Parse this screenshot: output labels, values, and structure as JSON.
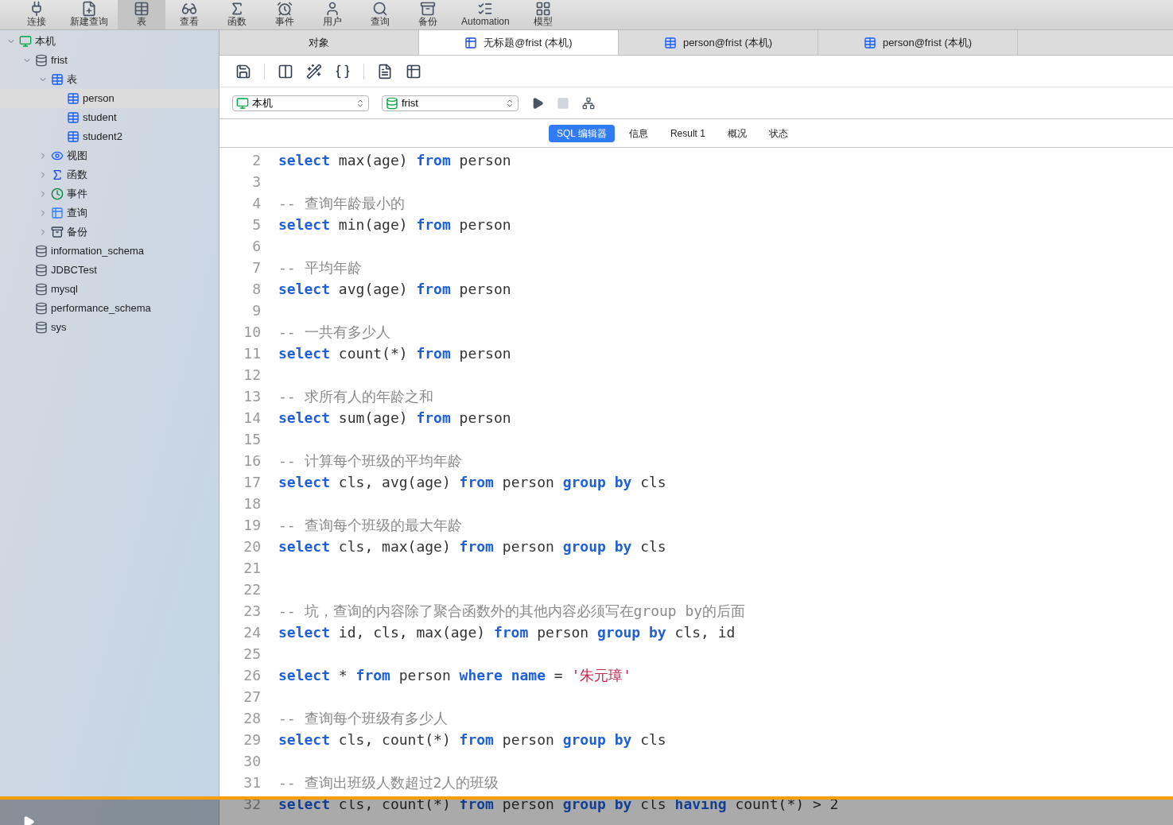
{
  "toolbar": [
    {
      "label": "连接",
      "kind": "connect",
      "selected": false
    },
    {
      "label": "新建查询",
      "kind": "newquery",
      "selected": false
    },
    {
      "label": "表",
      "kind": "table",
      "selected": true
    },
    {
      "label": "查看",
      "kind": "view",
      "selected": false
    },
    {
      "label": "函数",
      "kind": "function",
      "selected": false
    },
    {
      "label": "事件",
      "kind": "event",
      "selected": false
    },
    {
      "label": "用户",
      "kind": "user",
      "selected": false
    },
    {
      "label": "查询",
      "kind": "query",
      "selected": false
    },
    {
      "label": "备份",
      "kind": "backup",
      "selected": false
    },
    {
      "label": "Automation",
      "kind": "automation",
      "selected": false
    },
    {
      "label": "模型",
      "kind": "model",
      "selected": false
    }
  ],
  "sidebar": {
    "items": [
      {
        "label": "本机",
        "kind": "connection",
        "expanded": true,
        "selected": false,
        "children": [
          {
            "label": "frist",
            "kind": "database",
            "expanded": true,
            "selected": false,
            "children": [
              {
                "label": "表",
                "kind": "tables",
                "expanded": true,
                "selected": false,
                "children": [
                  {
                    "label": "person",
                    "kind": "table",
                    "selected": true
                  },
                  {
                    "label": "student",
                    "kind": "table",
                    "selected": false
                  },
                  {
                    "label": "student2",
                    "kind": "table",
                    "selected": false
                  }
                ]
              },
              {
                "label": "视图",
                "kind": "view",
                "expanded": false,
                "selected": false
              },
              {
                "label": "函数",
                "kind": "function",
                "expanded": false,
                "selected": false
              },
              {
                "label": "事件",
                "kind": "event",
                "expanded": false,
                "selected": false
              },
              {
                "label": "查询",
                "kind": "query",
                "expanded": false,
                "selected": false
              },
              {
                "label": "备份",
                "kind": "backup",
                "expanded": false,
                "selected": false
              }
            ]
          },
          {
            "label": "information_schema",
            "kind": "database",
            "selected": false
          },
          {
            "label": "JDBCTest",
            "kind": "database",
            "selected": false
          },
          {
            "label": "mysql",
            "kind": "database",
            "selected": false
          },
          {
            "label": "performance_schema",
            "kind": "database",
            "selected": false
          },
          {
            "label": "sys",
            "kind": "database",
            "selected": false
          }
        ]
      }
    ]
  },
  "tabs": [
    {
      "label": "对象",
      "kind": "objects",
      "selected": false
    },
    {
      "label": "无标题@frist (本机)",
      "kind": "query",
      "selected": true
    },
    {
      "label": "person@frist (本机)",
      "kind": "table",
      "selected": false
    },
    {
      "label": "person@frist (本机)",
      "kind": "table",
      "selected": false
    }
  ],
  "connection_select": {
    "value": "本机"
  },
  "database_select": {
    "value": "frist"
  },
  "editor_tabs": [
    {
      "label": "SQL 编辑器",
      "selected": true
    },
    {
      "label": "信息",
      "selected": false
    },
    {
      "label": "Result 1",
      "selected": false
    },
    {
      "label": "概况",
      "selected": false
    },
    {
      "label": "状态",
      "selected": false
    }
  ],
  "editor": {
    "lines": [
      {
        "number": "2",
        "tokens": [
          {
            "text": "select",
            "kind": "keyword"
          },
          {
            "text": " max(age) ",
            "kind": "plain"
          },
          {
            "text": "from",
            "kind": "keyword"
          },
          {
            "text": " person",
            "kind": "plain"
          }
        ]
      },
      {
        "number": "3"
      },
      {
        "number": "4",
        "tokens": [
          {
            "text": "-- 查询年龄最小的",
            "kind": "comment"
          }
        ]
      },
      {
        "number": "5",
        "tokens": [
          {
            "text": "select",
            "kind": "keyword"
          },
          {
            "text": " min(age) ",
            "kind": "plain"
          },
          {
            "text": "from",
            "kind": "keyword"
          },
          {
            "text": " person",
            "kind": "plain"
          }
        ]
      },
      {
        "number": "6"
      },
      {
        "number": "7",
        "tokens": [
          {
            "text": "-- 平均年龄",
            "kind": "comment"
          }
        ]
      },
      {
        "number": "8",
        "tokens": [
          {
            "text": "select",
            "kind": "keyword"
          },
          {
            "text": " avg(age) ",
            "kind": "plain"
          },
          {
            "text": "from",
            "kind": "keyword"
          },
          {
            "text": " person",
            "kind": "plain"
          }
        ]
      },
      {
        "number": "9"
      },
      {
        "number": "10",
        "tokens": [
          {
            "text": "-- 一共有多少人",
            "kind": "comment"
          }
        ]
      },
      {
        "number": "11",
        "tokens": [
          {
            "text": "select",
            "kind": "keyword"
          },
          {
            "text": " count(*) ",
            "kind": "plain"
          },
          {
            "text": "from",
            "kind": "keyword"
          },
          {
            "text": " person",
            "kind": "plain"
          }
        ]
      },
      {
        "number": "12"
      },
      {
        "number": "13",
        "tokens": [
          {
            "text": "-- 求所有人的年龄之和",
            "kind": "comment"
          }
        ]
      },
      {
        "number": "14",
        "tokens": [
          {
            "text": "select",
            "kind": "keyword"
          },
          {
            "text": " sum(age) ",
            "kind": "plain"
          },
          {
            "text": "from",
            "kind": "keyword"
          },
          {
            "text": " person",
            "kind": "plain"
          }
        ]
      },
      {
        "number": "15"
      },
      {
        "number": "16",
        "tokens": [
          {
            "text": "-- 计算每个班级的平均年龄",
            "kind": "comment"
          }
        ]
      },
      {
        "number": "17",
        "tokens": [
          {
            "text": "select",
            "kind": "keyword"
          },
          {
            "text": " cls, avg(age) ",
            "kind": "plain"
          },
          {
            "text": "from",
            "kind": "keyword"
          },
          {
            "text": " person ",
            "kind": "plain"
          },
          {
            "text": "group by",
            "kind": "keyword"
          },
          {
            "text": " cls",
            "kind": "plain"
          }
        ]
      },
      {
        "number": "18"
      },
      {
        "number": "19",
        "tokens": [
          {
            "text": "-- 查询每个班级的最大年龄",
            "kind": "comment"
          }
        ]
      },
      {
        "number": "20",
        "tokens": [
          {
            "text": "select",
            "kind": "keyword"
          },
          {
            "text": " cls, max(age) ",
            "kind": "plain"
          },
          {
            "text": "from",
            "kind": "keyword"
          },
          {
            "text": " person ",
            "kind": "plain"
          },
          {
            "text": "group by",
            "kind": "keyword"
          },
          {
            "text": " cls",
            "kind": "plain"
          }
        ]
      },
      {
        "number": "21"
      },
      {
        "number": "22"
      },
      {
        "number": "23",
        "tokens": [
          {
            "text": "-- 坑，查询的内容除了聚合函数外的其他内容必须写在group by的后面",
            "kind": "comment"
          }
        ]
      },
      {
        "number": "24",
        "tokens": [
          {
            "text": "select",
            "kind": "keyword"
          },
          {
            "text": " id, cls, max(age) ",
            "kind": "plain"
          },
          {
            "text": "from",
            "kind": "keyword"
          },
          {
            "text": " person ",
            "kind": "plain"
          },
          {
            "text": "group by",
            "kind": "keyword"
          },
          {
            "text": " cls, id",
            "kind": "plain"
          }
        ]
      },
      {
        "number": "25"
      },
      {
        "number": "26",
        "tokens": [
          {
            "text": "select",
            "kind": "keyword"
          },
          {
            "text": " * ",
            "kind": "plain"
          },
          {
            "text": "from",
            "kind": "keyword"
          },
          {
            "text": " person ",
            "kind": "plain"
          },
          {
            "text": "where name",
            "kind": "keyword"
          },
          {
            "text": " = ",
            "kind": "plain"
          },
          {
            "text": "'朱元璋'",
            "kind": "string"
          }
        ]
      },
      {
        "number": "27"
      },
      {
        "number": "28",
        "tokens": [
          {
            "text": "-- 查询每个班级有多少人",
            "kind": "comment"
          }
        ]
      },
      {
        "number": "29",
        "tokens": [
          {
            "text": "select",
            "kind": "keyword"
          },
          {
            "text": " cls, count(*) ",
            "kind": "plain"
          },
          {
            "text": "from",
            "kind": "keyword"
          },
          {
            "text": " person ",
            "kind": "plain"
          },
          {
            "text": "group by",
            "kind": "keyword"
          },
          {
            "text": " cls",
            "kind": "plain"
          }
        ]
      },
      {
        "number": "30"
      },
      {
        "number": "31",
        "tokens": [
          {
            "text": "-- 查询出班级人数超过2人的班级",
            "kind": "comment"
          }
        ]
      },
      {
        "number": "32",
        "tokens": [
          {
            "text": "select",
            "kind": "keyword"
          },
          {
            "text": " cls, count(*) ",
            "kind": "plain"
          },
          {
            "text": "from",
            "kind": "keyword"
          },
          {
            "text": " person ",
            "kind": "plain"
          },
          {
            "text": "group by",
            "kind": "keyword"
          },
          {
            "text": " cls ",
            "kind": "plain"
          },
          {
            "text": "having",
            "kind": "keyword"
          },
          {
            "text": " count(*) > 2",
            "kind": "plain"
          }
        ]
      }
    ]
  }
}
